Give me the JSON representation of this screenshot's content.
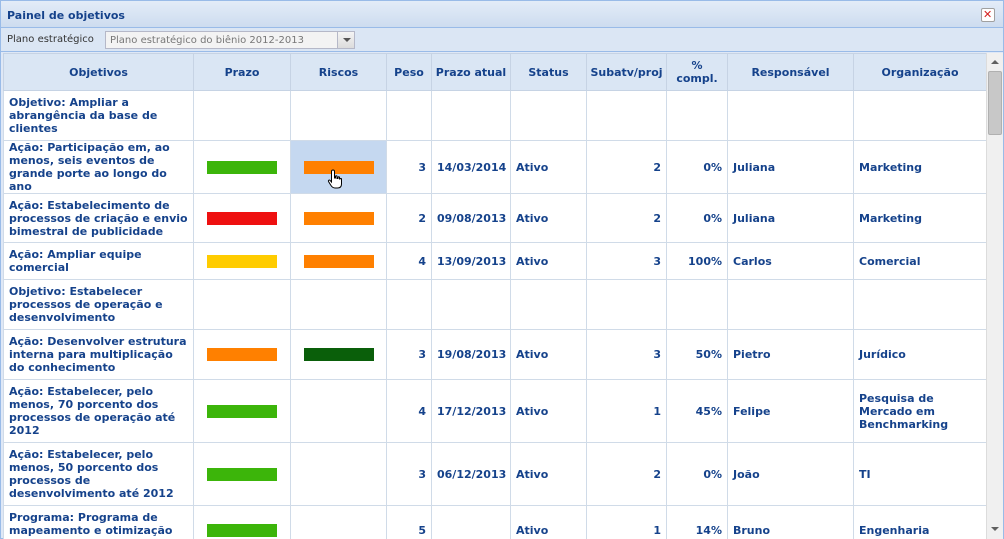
{
  "window": {
    "title": "Painel de objetivos",
    "close_icon": "close-icon"
  },
  "toolbar": {
    "plan_label": "Plano estratégico",
    "plan_value": "Plano estratégico do biênio 2012-2013"
  },
  "columns": [
    "Objetivos",
    "Prazo",
    "Riscos",
    "Peso",
    "Prazo atual",
    "Status",
    "Subatv/proj",
    "% compl.",
    "Responsável",
    "Organização"
  ],
  "colors": {
    "green": "#3cb50a",
    "orange": "#ff8000",
    "red": "#ee1010",
    "yellow": "#ffcc00",
    "dark_green": "#0a5f0a",
    "selected_cell": "#c5d8f0"
  },
  "rows": [
    {
      "kind": "objective",
      "objetivo": "Objetivo: Ampliar a abrangência da base de clientes"
    },
    {
      "kind": "action",
      "objetivo": "Ação: Participação em, ao menos, seis eventos de grande porte ao longo do ano",
      "prazo_color": "green",
      "riscos_color": "orange",
      "riscos_selected": true,
      "peso": "3",
      "prazo_atual": "14/03/2014",
      "status": "Ativo",
      "subatv": "2",
      "compl": "0%",
      "responsavel": "Juliana",
      "organizacao": "Marketing"
    },
    {
      "kind": "action",
      "objetivo": "Ação: Estabelecimento de processos de criação e envio bimestral de publicidade",
      "prazo_color": "red",
      "riscos_color": "orange",
      "peso": "2",
      "prazo_atual": "09/08/2013",
      "status": "Ativo",
      "subatv": "2",
      "compl": "0%",
      "responsavel": "Juliana",
      "organizacao": "Marketing"
    },
    {
      "kind": "action",
      "objetivo": "Ação: Ampliar equipe comercial",
      "prazo_color": "yellow",
      "riscos_color": "orange",
      "peso": "4",
      "prazo_atual": "13/09/2013",
      "status": "Ativo",
      "subatv": "3",
      "compl": "100%",
      "responsavel": "Carlos",
      "organizacao": "Comercial"
    },
    {
      "kind": "objective",
      "objetivo": "Objetivo: Estabelecer processos de operação e desenvolvimento"
    },
    {
      "kind": "action",
      "objetivo": "Ação: Desenvolver estrutura interna para multiplicação do conhecimento",
      "prazo_color": "orange",
      "riscos_color": "dark_green",
      "peso": "3",
      "prazo_atual": "19/08/2013",
      "status": "Ativo",
      "subatv": "3",
      "compl": "50%",
      "responsavel": "Pietro",
      "organizacao": "Jurídico"
    },
    {
      "kind": "action",
      "objetivo": "Ação: Estabelecer, pelo menos, 70 porcento dos processos de operação até 2012",
      "prazo_color": "green",
      "riscos_color": "",
      "peso": "4",
      "prazo_atual": "17/12/2013",
      "status": "Ativo",
      "subatv": "1",
      "compl": "45%",
      "responsavel": "Felipe",
      "organizacao": "Pesquisa de Mercado em Benchmarking"
    },
    {
      "kind": "action",
      "objetivo": "Ação: Estabelecer, pelo menos, 50 porcento dos processos de desenvolvimento até 2012",
      "prazo_color": "green",
      "riscos_color": "",
      "peso": "3",
      "prazo_atual": "06/12/2013",
      "status": "Ativo",
      "subatv": "2",
      "compl": "0%",
      "responsavel": "João",
      "organizacao": "TI"
    },
    {
      "kind": "action",
      "objetivo": "Programa: Programa de mapeamento e otimização dos",
      "prazo_color": "green",
      "riscos_color": "",
      "peso": "5",
      "prazo_atual": "",
      "status": "Ativo",
      "subatv": "1",
      "compl": "14%",
      "responsavel": "Bruno",
      "organizacao": "Engenharia"
    }
  ]
}
